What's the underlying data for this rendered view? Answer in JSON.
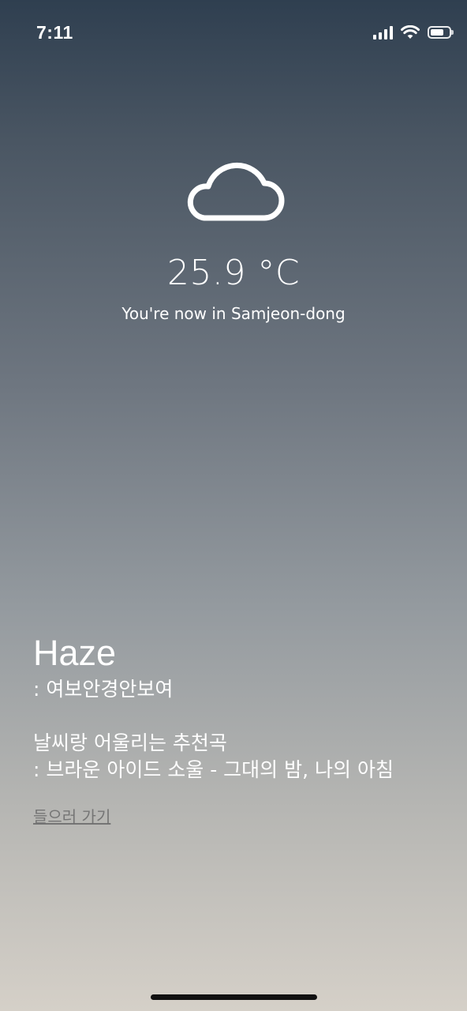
{
  "status_bar": {
    "time": "7:11",
    "icons": [
      "signal-icon",
      "wifi-icon",
      "battery-icon"
    ]
  },
  "weather": {
    "icon": "cloud-icon",
    "temperature": "25.9 °C",
    "location": "You're now in Samjeon-dong"
  },
  "info": {
    "condition": "Haze",
    "condition_desc": " : 여보안경안보여",
    "song_title": "날씨랑 어울리는 추천곡",
    "song_desc": " : 브라운 아이드 소울 - 그대의 밤, 나의 아침",
    "listen_link": "들으러 가기"
  },
  "colors": {
    "gradient_top": "#2f3f50",
    "gradient_bottom": "#d5d0c8",
    "text": "#ffffff",
    "link": "#6e6e6e"
  }
}
